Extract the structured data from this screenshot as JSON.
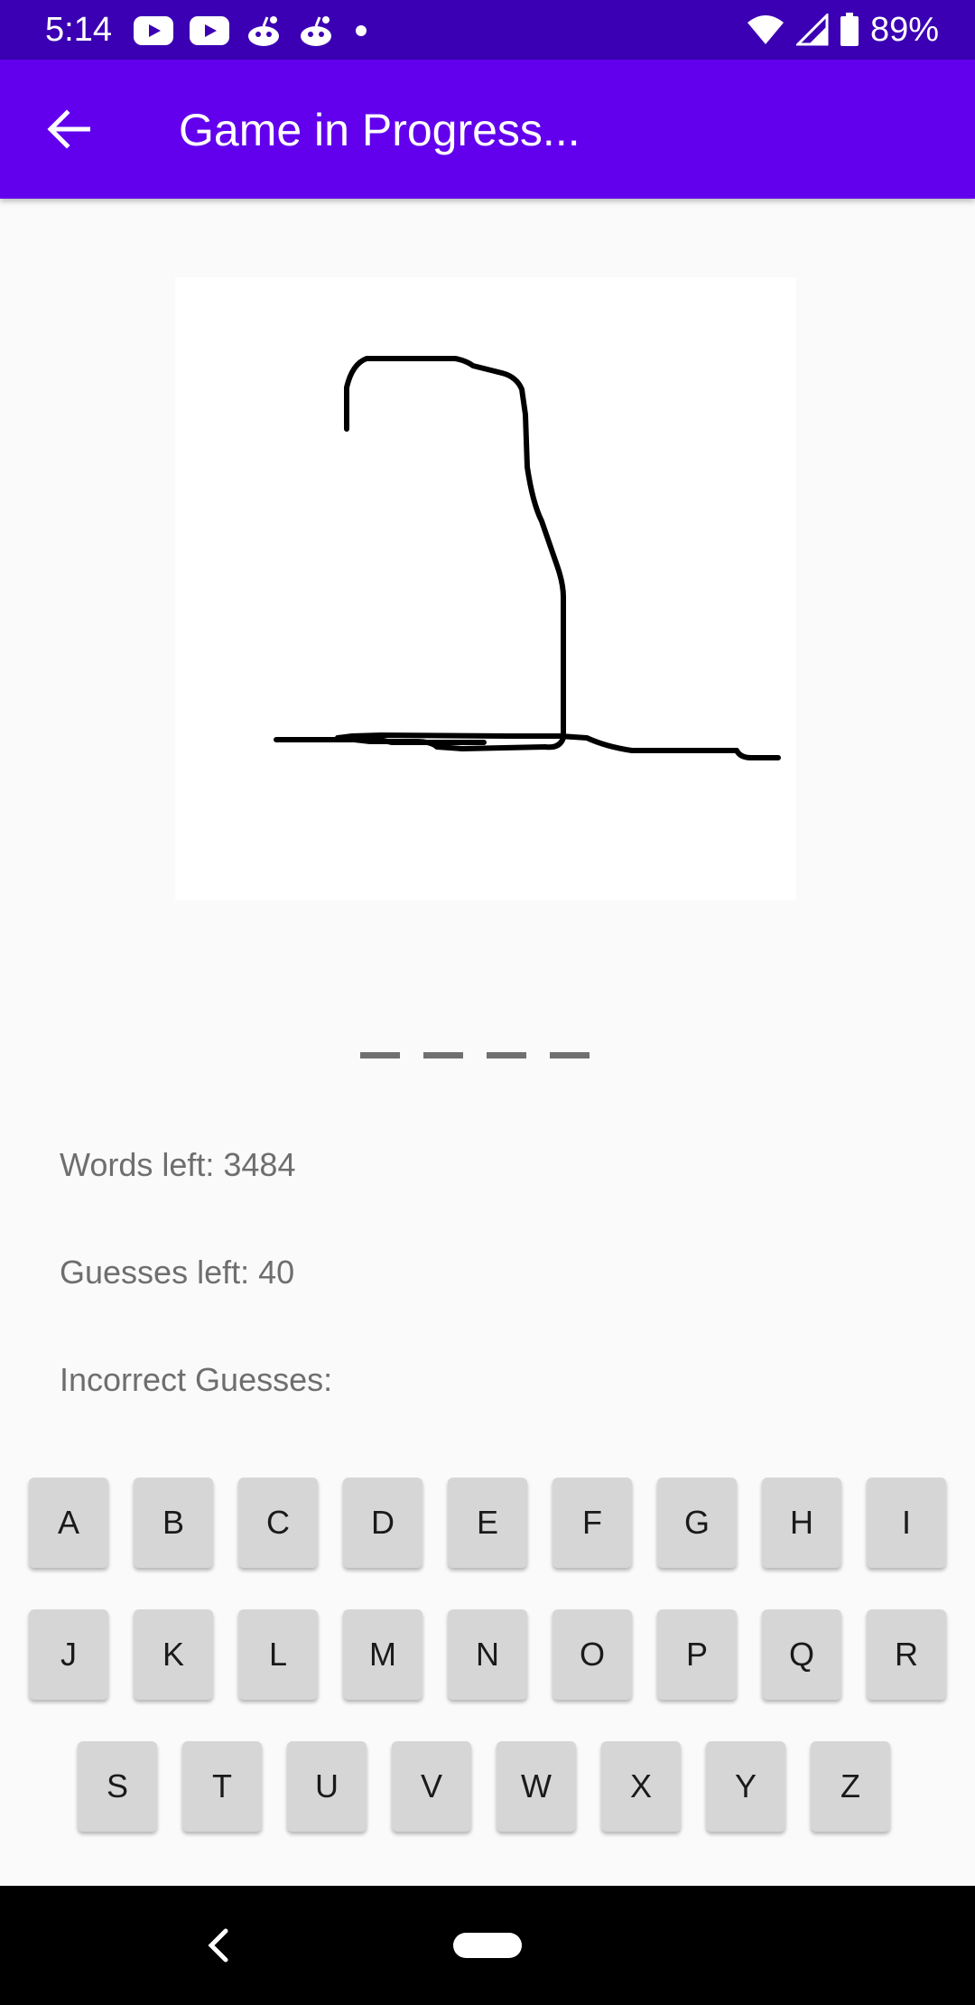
{
  "status_bar": {
    "time": "5:14",
    "battery": "89%",
    "icons_left": [
      "youtube-icon",
      "youtube-icon",
      "reddit-icon",
      "reddit-icon",
      "dot-icon"
    ],
    "icons_right": [
      "wifi-icon",
      "signal-icon",
      "battery-icon"
    ]
  },
  "app_bar": {
    "title": "Game in Progress...",
    "back_icon": "arrow-left-icon",
    "color": "#6200ee"
  },
  "word_blanks": [
    "_",
    "_",
    "_",
    "_"
  ],
  "stats": {
    "words_left": "Words left: 3484",
    "guesses_left": "Guesses left: 40",
    "incorrect_guesses": "Incorrect Guesses:"
  },
  "keyboard": {
    "row1": [
      "A",
      "B",
      "C",
      "D",
      "E",
      "F",
      "G",
      "H",
      "I"
    ],
    "row2": [
      "J",
      "K",
      "L",
      "M",
      "N",
      "O",
      "P",
      "Q",
      "R"
    ],
    "row3": [
      "S",
      "T",
      "U",
      "V",
      "W",
      "X",
      "Y",
      "Z"
    ]
  },
  "nav_bar": {
    "back_icon": "chevron-left-icon",
    "home_icon": "home-pill-icon"
  }
}
